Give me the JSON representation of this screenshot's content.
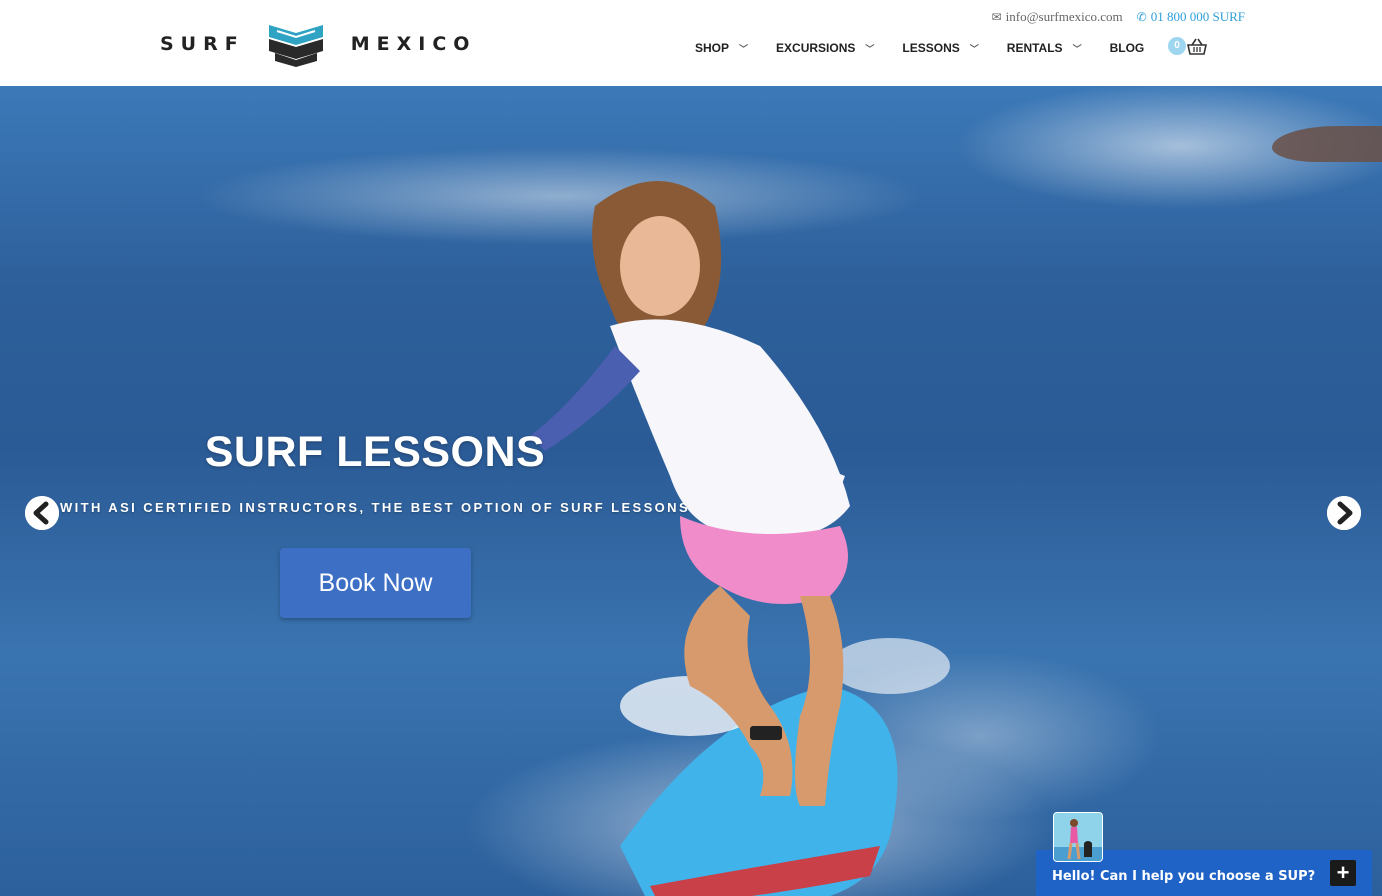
{
  "brand": {
    "left_word": "SURF",
    "right_word": "MEXICO",
    "accent": "#2fa3c4"
  },
  "contact": {
    "email": "info@surfmexico.com",
    "phone": "01 800 000 SURF",
    "email_icon": "envelope-icon",
    "phone_icon": "phone-icon"
  },
  "nav": {
    "items": [
      {
        "label": "SHOP",
        "has_dropdown": true
      },
      {
        "label": "EXCURSIONS",
        "has_dropdown": true
      },
      {
        "label": "LESSONS",
        "has_dropdown": true
      },
      {
        "label": "RENTALS",
        "has_dropdown": true
      },
      {
        "label": "BLOG",
        "has_dropdown": false
      }
    ],
    "cart_count": "0",
    "cart_icon": "basket-icon"
  },
  "hero": {
    "title": "SURF LESSONS",
    "subtitle": "WITH ASI CERTIFIED INSTRUCTORS, THE BEST OPTION OF SURF LESSONS",
    "cta_label": "Book Now",
    "cta_color": "#3d6fc5",
    "prev_icon": "chevron-left-circle-icon",
    "next_icon": "chevron-right-circle-icon"
  },
  "chat": {
    "message": "Hello! Can I help you choose a SUP?",
    "close_icon": "plus-icon",
    "color": "#1f63c6"
  }
}
